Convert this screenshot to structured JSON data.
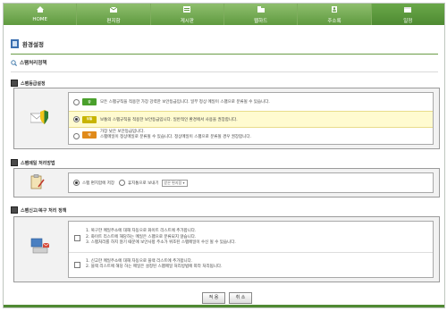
{
  "nav": {
    "items": [
      {
        "label": "HOME",
        "icon": "home-icon"
      },
      {
        "label": "편지함",
        "icon": "mailbox-icon"
      },
      {
        "label": "게시판",
        "icon": "board-icon"
      },
      {
        "label": "웹하드",
        "icon": "webhard-icon"
      },
      {
        "label": "주소록",
        "icon": "addressbook-icon"
      },
      {
        "label": "일정",
        "icon": "calendar-icon"
      }
    ],
    "active_index": 5
  },
  "page_title": "환경설정",
  "subheading": "스팸처리정책",
  "sections": {
    "level": {
      "title": "스팸등급설정",
      "options": [
        {
          "badge": "강",
          "badge_color": "#4aa02c",
          "text": "모든 스팸규칙을 적용한 가장 강력한 보안등급입니다. 일부 정상 메일이 스팸으로 분류될 수 있습니다.",
          "selected": false
        },
        {
          "badge": "보통",
          "badge_color": "#c8b400",
          "text": "보통의 스팸규칙을 적용한 보안등급입니다. 일반적인 환경에서 사용을 권장합니다.",
          "selected": true
        },
        {
          "badge": "약",
          "badge_color": "#e08a1a",
          "text_line1": "가장 낮은 보안등급입니다.",
          "text_line2": "스팸메일이 정상메일로 분류될 수 있습니다. 정상메일이 스팸으로 분류될 경우 권장합니다.",
          "selected": false
        }
      ]
    },
    "method": {
      "title": "스팸메일 처리방법",
      "option1": "스팸 편지함에 저장",
      "option2": "휴지통으로 보내기",
      "select_value": "받은 편지함"
    },
    "lists": {
      "title": "스팸신고/복구 처리 정책",
      "block1": [
        "1. 복구한 메일주소에 대해 자동으로 화이트 리스트에 추가합니다.",
        "2. 화이트 리스트에 해당하는 메일은 스팸으로 분류되지 않습니다.",
        "3. 스팸처리를 하지 않기 때문에 보안사항 주소가 위조된 스팸메일이 수신 될 수 있습니다."
      ],
      "block2": [
        "1. 신고한 메일주소에 대해 자동으로 블랙 리스트에 추가합니다.",
        "2. 블랙 리스트에 해당 하는 메일은 설정된 스팸메일 처리방법에 따라 처리됩니다."
      ]
    }
  },
  "buttons": {
    "apply": "적 용",
    "cancel": "취 소"
  },
  "colors": {
    "nav": "#6aa84a",
    "highlight_row": "#fffbd0"
  }
}
